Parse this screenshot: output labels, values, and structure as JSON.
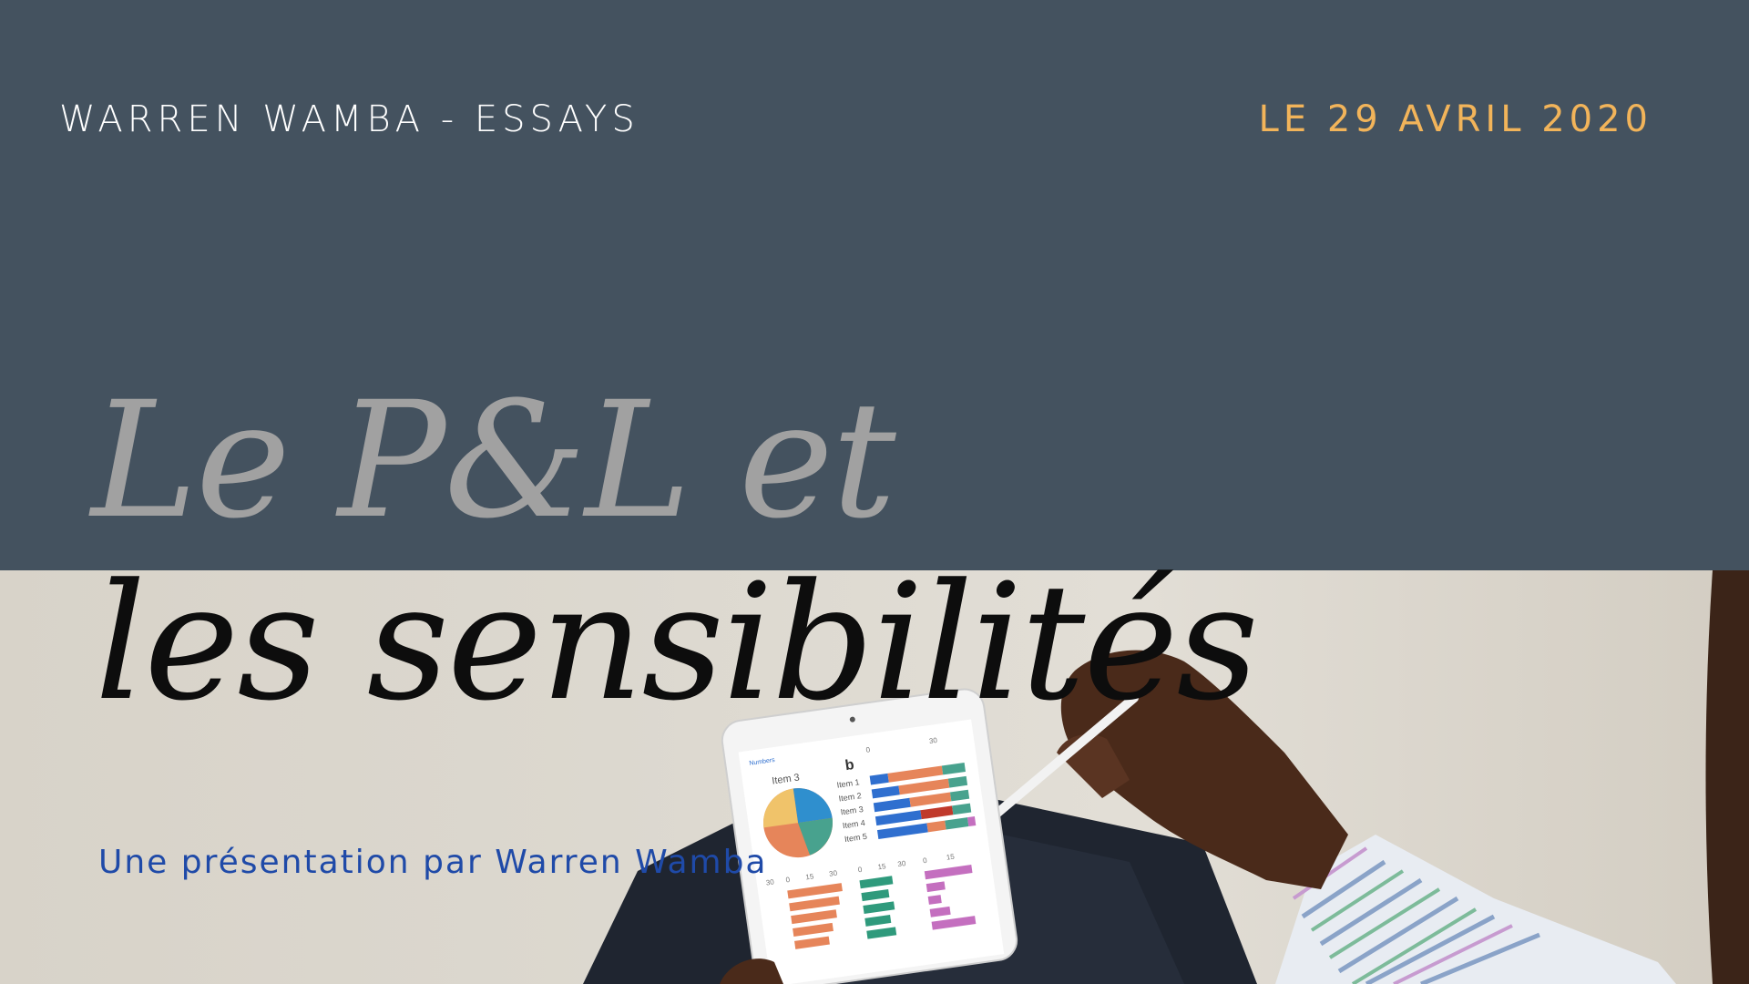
{
  "header": {
    "author_label": "WARREN WAMBA - ESSAYS",
    "date_label": "LE 29 AVRIL 2020"
  },
  "title": {
    "line1": "Le P&L et",
    "line2": "les sensibilités"
  },
  "subtitle": "Une présentation par Warren Wamba",
  "photo": {
    "tablet_screen": {
      "back_label": "Numbers",
      "pie_title": "Item 3",
      "bar_title": "b",
      "bar_items": [
        "Item 1",
        "Item 2",
        "Item 3",
        "Item 4",
        "Item 5"
      ],
      "axis_top": [
        "0",
        "30"
      ],
      "axis_bottom": [
        "30",
        "0",
        "15",
        "30",
        "0",
        "15",
        "30",
        "0",
        "15"
      ]
    }
  },
  "colors": {
    "background_band": "#44525f",
    "date_accent": "#f2b45a",
    "title_gray": "#a1a1a1",
    "title_black": "#0d0d0d",
    "subtitle_blue": "#1f4aa8"
  }
}
